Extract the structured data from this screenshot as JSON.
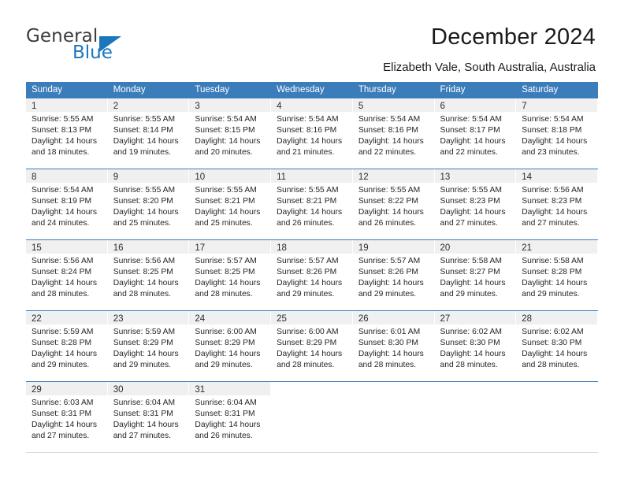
{
  "logo": {
    "word_top": "General",
    "word_bottom": "Blue",
    "triangle_icon": "triangle-icon",
    "brand_color": "#1b76bc"
  },
  "header": {
    "title": "December 2024",
    "subtitle": "Elizabeth Vale, South Australia, Australia"
  },
  "calendar": {
    "header_bg": "#3b7cba",
    "daynumber_bg": "#f0f0f0",
    "weekdays": [
      "Sunday",
      "Monday",
      "Tuesday",
      "Wednesday",
      "Thursday",
      "Friday",
      "Saturday"
    ],
    "weeks": [
      [
        {
          "day": "1",
          "info": "Sunrise: 5:55 AM\nSunset: 8:13 PM\nDaylight: 14 hours\nand 18 minutes."
        },
        {
          "day": "2",
          "info": "Sunrise: 5:55 AM\nSunset: 8:14 PM\nDaylight: 14 hours\nand 19 minutes."
        },
        {
          "day": "3",
          "info": "Sunrise: 5:54 AM\nSunset: 8:15 PM\nDaylight: 14 hours\nand 20 minutes."
        },
        {
          "day": "4",
          "info": "Sunrise: 5:54 AM\nSunset: 8:16 PM\nDaylight: 14 hours\nand 21 minutes."
        },
        {
          "day": "5",
          "info": "Sunrise: 5:54 AM\nSunset: 8:16 PM\nDaylight: 14 hours\nand 22 minutes."
        },
        {
          "day": "6",
          "info": "Sunrise: 5:54 AM\nSunset: 8:17 PM\nDaylight: 14 hours\nand 22 minutes."
        },
        {
          "day": "7",
          "info": "Sunrise: 5:54 AM\nSunset: 8:18 PM\nDaylight: 14 hours\nand 23 minutes."
        }
      ],
      [
        {
          "day": "8",
          "info": "Sunrise: 5:54 AM\nSunset: 8:19 PM\nDaylight: 14 hours\nand 24 minutes."
        },
        {
          "day": "9",
          "info": "Sunrise: 5:55 AM\nSunset: 8:20 PM\nDaylight: 14 hours\nand 25 minutes."
        },
        {
          "day": "10",
          "info": "Sunrise: 5:55 AM\nSunset: 8:21 PM\nDaylight: 14 hours\nand 25 minutes."
        },
        {
          "day": "11",
          "info": "Sunrise: 5:55 AM\nSunset: 8:21 PM\nDaylight: 14 hours\nand 26 minutes."
        },
        {
          "day": "12",
          "info": "Sunrise: 5:55 AM\nSunset: 8:22 PM\nDaylight: 14 hours\nand 26 minutes."
        },
        {
          "day": "13",
          "info": "Sunrise: 5:55 AM\nSunset: 8:23 PM\nDaylight: 14 hours\nand 27 minutes."
        },
        {
          "day": "14",
          "info": "Sunrise: 5:56 AM\nSunset: 8:23 PM\nDaylight: 14 hours\nand 27 minutes."
        }
      ],
      [
        {
          "day": "15",
          "info": "Sunrise: 5:56 AM\nSunset: 8:24 PM\nDaylight: 14 hours\nand 28 minutes."
        },
        {
          "day": "16",
          "info": "Sunrise: 5:56 AM\nSunset: 8:25 PM\nDaylight: 14 hours\nand 28 minutes."
        },
        {
          "day": "17",
          "info": "Sunrise: 5:57 AM\nSunset: 8:25 PM\nDaylight: 14 hours\nand 28 minutes."
        },
        {
          "day": "18",
          "info": "Sunrise: 5:57 AM\nSunset: 8:26 PM\nDaylight: 14 hours\nand 29 minutes."
        },
        {
          "day": "19",
          "info": "Sunrise: 5:57 AM\nSunset: 8:26 PM\nDaylight: 14 hours\nand 29 minutes."
        },
        {
          "day": "20",
          "info": "Sunrise: 5:58 AM\nSunset: 8:27 PM\nDaylight: 14 hours\nand 29 minutes."
        },
        {
          "day": "21",
          "info": "Sunrise: 5:58 AM\nSunset: 8:28 PM\nDaylight: 14 hours\nand 29 minutes."
        }
      ],
      [
        {
          "day": "22",
          "info": "Sunrise: 5:59 AM\nSunset: 8:28 PM\nDaylight: 14 hours\nand 29 minutes."
        },
        {
          "day": "23",
          "info": "Sunrise: 5:59 AM\nSunset: 8:29 PM\nDaylight: 14 hours\nand 29 minutes."
        },
        {
          "day": "24",
          "info": "Sunrise: 6:00 AM\nSunset: 8:29 PM\nDaylight: 14 hours\nand 29 minutes."
        },
        {
          "day": "25",
          "info": "Sunrise: 6:00 AM\nSunset: 8:29 PM\nDaylight: 14 hours\nand 28 minutes."
        },
        {
          "day": "26",
          "info": "Sunrise: 6:01 AM\nSunset: 8:30 PM\nDaylight: 14 hours\nand 28 minutes."
        },
        {
          "day": "27",
          "info": "Sunrise: 6:02 AM\nSunset: 8:30 PM\nDaylight: 14 hours\nand 28 minutes."
        },
        {
          "day": "28",
          "info": "Sunrise: 6:02 AM\nSunset: 8:30 PM\nDaylight: 14 hours\nand 28 minutes."
        }
      ],
      [
        {
          "day": "29",
          "info": "Sunrise: 6:03 AM\nSunset: 8:31 PM\nDaylight: 14 hours\nand 27 minutes."
        },
        {
          "day": "30",
          "info": "Sunrise: 6:04 AM\nSunset: 8:31 PM\nDaylight: 14 hours\nand 27 minutes."
        },
        {
          "day": "31",
          "info": "Sunrise: 6:04 AM\nSunset: 8:31 PM\nDaylight: 14 hours\nand 26 minutes."
        },
        {
          "day": "",
          "info": ""
        },
        {
          "day": "",
          "info": ""
        },
        {
          "day": "",
          "info": ""
        },
        {
          "day": "",
          "info": ""
        }
      ]
    ]
  }
}
